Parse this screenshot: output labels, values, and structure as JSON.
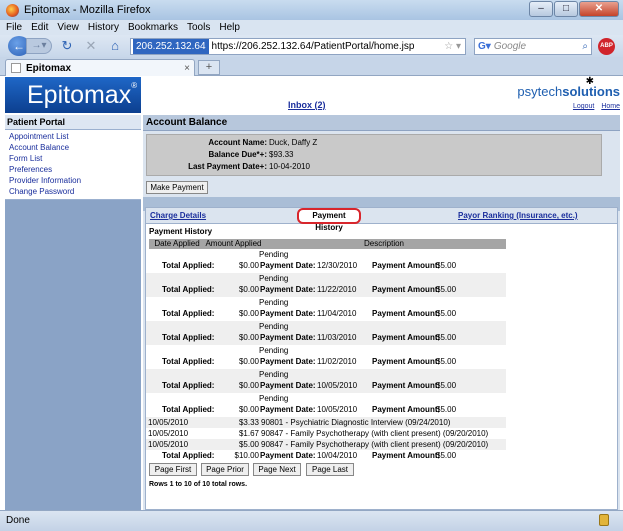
{
  "window": {
    "title": "Epitomax - Mozilla Firefox",
    "buttons": {
      "minimize": "–",
      "maximize": "□",
      "close": "✕"
    }
  },
  "menubar": [
    "File",
    "Edit",
    "View",
    "History",
    "Bookmarks",
    "Tools",
    "Help"
  ],
  "navbar": {
    "host": "206.252.132.64",
    "url": "https://206.252.132.64/PatientPortal/home.jsp",
    "search_placeholder": "Google"
  },
  "browser_tab": {
    "title": "Epitomax"
  },
  "header": {
    "logo": "Epitomax",
    "logo_mark": "®",
    "inbox": "Inbox (2)",
    "brand_prefix": "psytech",
    "brand_suffix": "solutions",
    "logout": "Logout",
    "home": "Home"
  },
  "sidebar": {
    "section": "Patient Portal",
    "items": [
      "Appointment List",
      "Account Balance",
      "Form List",
      "Preferences",
      "Provider Information",
      "Change Password"
    ]
  },
  "account": {
    "heading": "Account Balance",
    "rows": [
      {
        "label": "Account Name:",
        "value": "Duck, Daffy Z"
      },
      {
        "label": "Balance Due*+:",
        "value": "$93.33"
      },
      {
        "label": "Last Payment Date+:",
        "value": "10-04-2010"
      }
    ],
    "make_payment": "Make Payment"
  },
  "tabs": {
    "charge_details": "Charge Details",
    "payment_history": "Payment History",
    "payor_ranking": "Payor Ranking (Insurance, etc.)"
  },
  "history": {
    "title": "Payment History",
    "columns": [
      "Date Applied",
      "Amount Applied",
      "Description"
    ],
    "labels": {
      "total_applied": "Total Applied:",
      "payment_date": "Payment Date:",
      "payment_amount": "Payment Amount:"
    },
    "pending_rows": [
      {
        "status": "Pending",
        "total": "$0.00",
        "date": "12/30/2010",
        "amount": "$5.00"
      },
      {
        "status": "Pending",
        "total": "$0.00",
        "date": "11/22/2010",
        "amount": "$5.00"
      },
      {
        "status": "Pending",
        "total": "$0.00",
        "date": "11/04/2010",
        "amount": "$5.00"
      },
      {
        "status": "Pending",
        "total": "$0.00",
        "date": "11/03/2010",
        "amount": "$5.00"
      },
      {
        "status": "Pending",
        "total": "$0.00",
        "date": "11/02/2010",
        "amount": "$5.00"
      },
      {
        "status": "Pending",
        "total": "$0.00",
        "date": "10/05/2010",
        "amount": "$5.00"
      },
      {
        "status": "Pending",
        "total": "$0.00",
        "date": "10/05/2010",
        "amount": "$5.00"
      }
    ],
    "line_items": [
      {
        "date": "10/05/2010",
        "amount": "$3.33",
        "desc": "90801 - Psychiatric Diagnostic Interview (09/24/2010)"
      },
      {
        "date": "10/05/2010",
        "amount": "$1.67",
        "desc": "90847 - Family Psychotherapy (with client present) (09/20/2010)"
      },
      {
        "date": "10/05/2010",
        "amount": "$5.00",
        "desc": "90847 - Family Psychotherapy (with client present) (09/20/2010)"
      }
    ],
    "final_total": {
      "total": "$10.00",
      "date": "10/04/2010",
      "amount": "$5.00"
    },
    "buttons": [
      "Page First",
      "Page Prior",
      "Page Next",
      "Page Last"
    ],
    "row_count": "Rows 1 to 10 of 10 total rows."
  },
  "status": "Done",
  "colors": {
    "accent": "#1f67c7",
    "highlight_ring": "#d8262c",
    "link": "#1a2e9c"
  }
}
